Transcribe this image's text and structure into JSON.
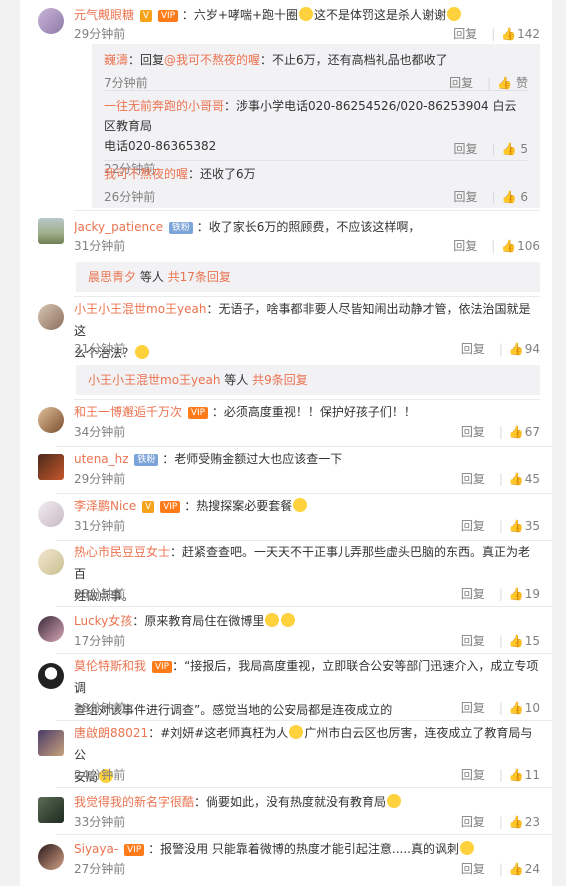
{
  "comments": [
    {
      "name": "元气觍眼糖",
      "badge": "V",
      "badge2": "VIP",
      "text": "：六岁+哮喘+跑十圈",
      "text2": "这不是体罚这是杀人谢谢",
      "time": "29分钟前",
      "reply": "回复",
      "likes": "142"
    },
    {
      "name": "Jacky_patience",
      "badge": "铁粉",
      "text": "：收了家长6万的照顾费，不应该这样啊，",
      "time": "31分钟前",
      "reply": "回复",
      "likes": "106"
    },
    {
      "name": "小王小王混世mo王yeah",
      "text": "：无语子，啥事都非要人尽皆知闹出动静才管，依法治国就是这",
      "text2": "么个治法？",
      "time": "31分钟前",
      "reply": "回复",
      "likes": "94"
    },
    {
      "name": "和王一博邂逅千万次",
      "badge": "VIP",
      "text": "：必须高度重视！！保护好孩子们！！",
      "time": "34分钟前",
      "reply": "回复",
      "likes": "67"
    },
    {
      "name": "utena_hz",
      "badge": "铁粉",
      "text": "：老师受贿金额过大也应该查一下",
      "time": "29分钟前",
      "reply": "回复",
      "likes": "45"
    },
    {
      "name": "李泽鹏Nice",
      "badge": "V",
      "badge2": "VIP",
      "text": "：热搜探案必要套餐",
      "time": "31分钟前",
      "reply": "回复",
      "likes": "35"
    },
    {
      "name": "热心市民豆豆女士",
      "text": "：赶紧查查吧。一天天不干正事儿弄那些虚头巴脑的东西。真正为老百",
      "text2": "姓做点事。",
      "time": "28分钟前",
      "reply": "回复",
      "likes": "19"
    },
    {
      "name": "Lucky女孩",
      "text": "：原来教育局住在微博里",
      "time": "17分钟前",
      "reply": "回复",
      "likes": "15"
    },
    {
      "name": "莫伦特斯和我",
      "badge": "VIP",
      "text": "：“接报后，我局高度重视，立即联合公安等部门迅速介入，成立专项调",
      "text2": "查组对该事件进行调查”。感觉当地的公安局都是连夜成立的",
      "time": "18分钟前",
      "reply": "回复",
      "likes": "10"
    },
    {
      "name": "唐啟朗88021",
      "text": "：#刘妍#这老师真枉为人",
      "text_b": "广州市白云区也厉害，连夜成立了教育局与公",
      "text2": "安局",
      "time": "24分钟前",
      "reply": "回复",
      "likes": "11"
    },
    {
      "name": "我觉得我的新名字很酷",
      "text": "：倘要如此，没有热度就没有教育局",
      "time": "33分钟前",
      "reply": "回复",
      "likes": "23"
    },
    {
      "name": "Siyaya-",
      "badge": "VIP",
      "text": "：报警没用 只能靠着微博的热度才能引起注意.....真的讽刺",
      "time": "27分钟前",
      "reply": "回复",
      "likes": "24"
    }
  ],
  "nested": [
    {
      "name": "巍濤",
      "text": "：回复",
      "mention": "@我可不熬夜的喔",
      "text_b": "：不止6万，还有高档礼品也都收了",
      "time": "7分钟前",
      "reply": "回复",
      "likes": "赞"
    },
    {
      "name": "一往无前奔跑的小哥哥",
      "text": "：涉事小学电话020-86254526/020-86253904 白云区教育局",
      "text2": "电话020-86365382",
      "time": "22分钟前",
      "reply": "回复",
      "likes": "5"
    },
    {
      "name": "我可不熬夜的喔",
      "text": "：还收了6万",
      "time": "26分钟前",
      "reply": "回复",
      "likes": "6"
    }
  ],
  "more": [
    {
      "name": "晨思青夕",
      "text": " 等人 ",
      "count": "共17条回复"
    },
    {
      "name": "小王小王混世mo王yeah",
      "text": " 等人 ",
      "count": "共9条回复"
    }
  ],
  "colors": {
    "name": "#eb7350",
    "muted": "#808080",
    "nest_bg": "#f2f2f5"
  },
  "icons": {
    "like": "thumb-up-icon"
  }
}
